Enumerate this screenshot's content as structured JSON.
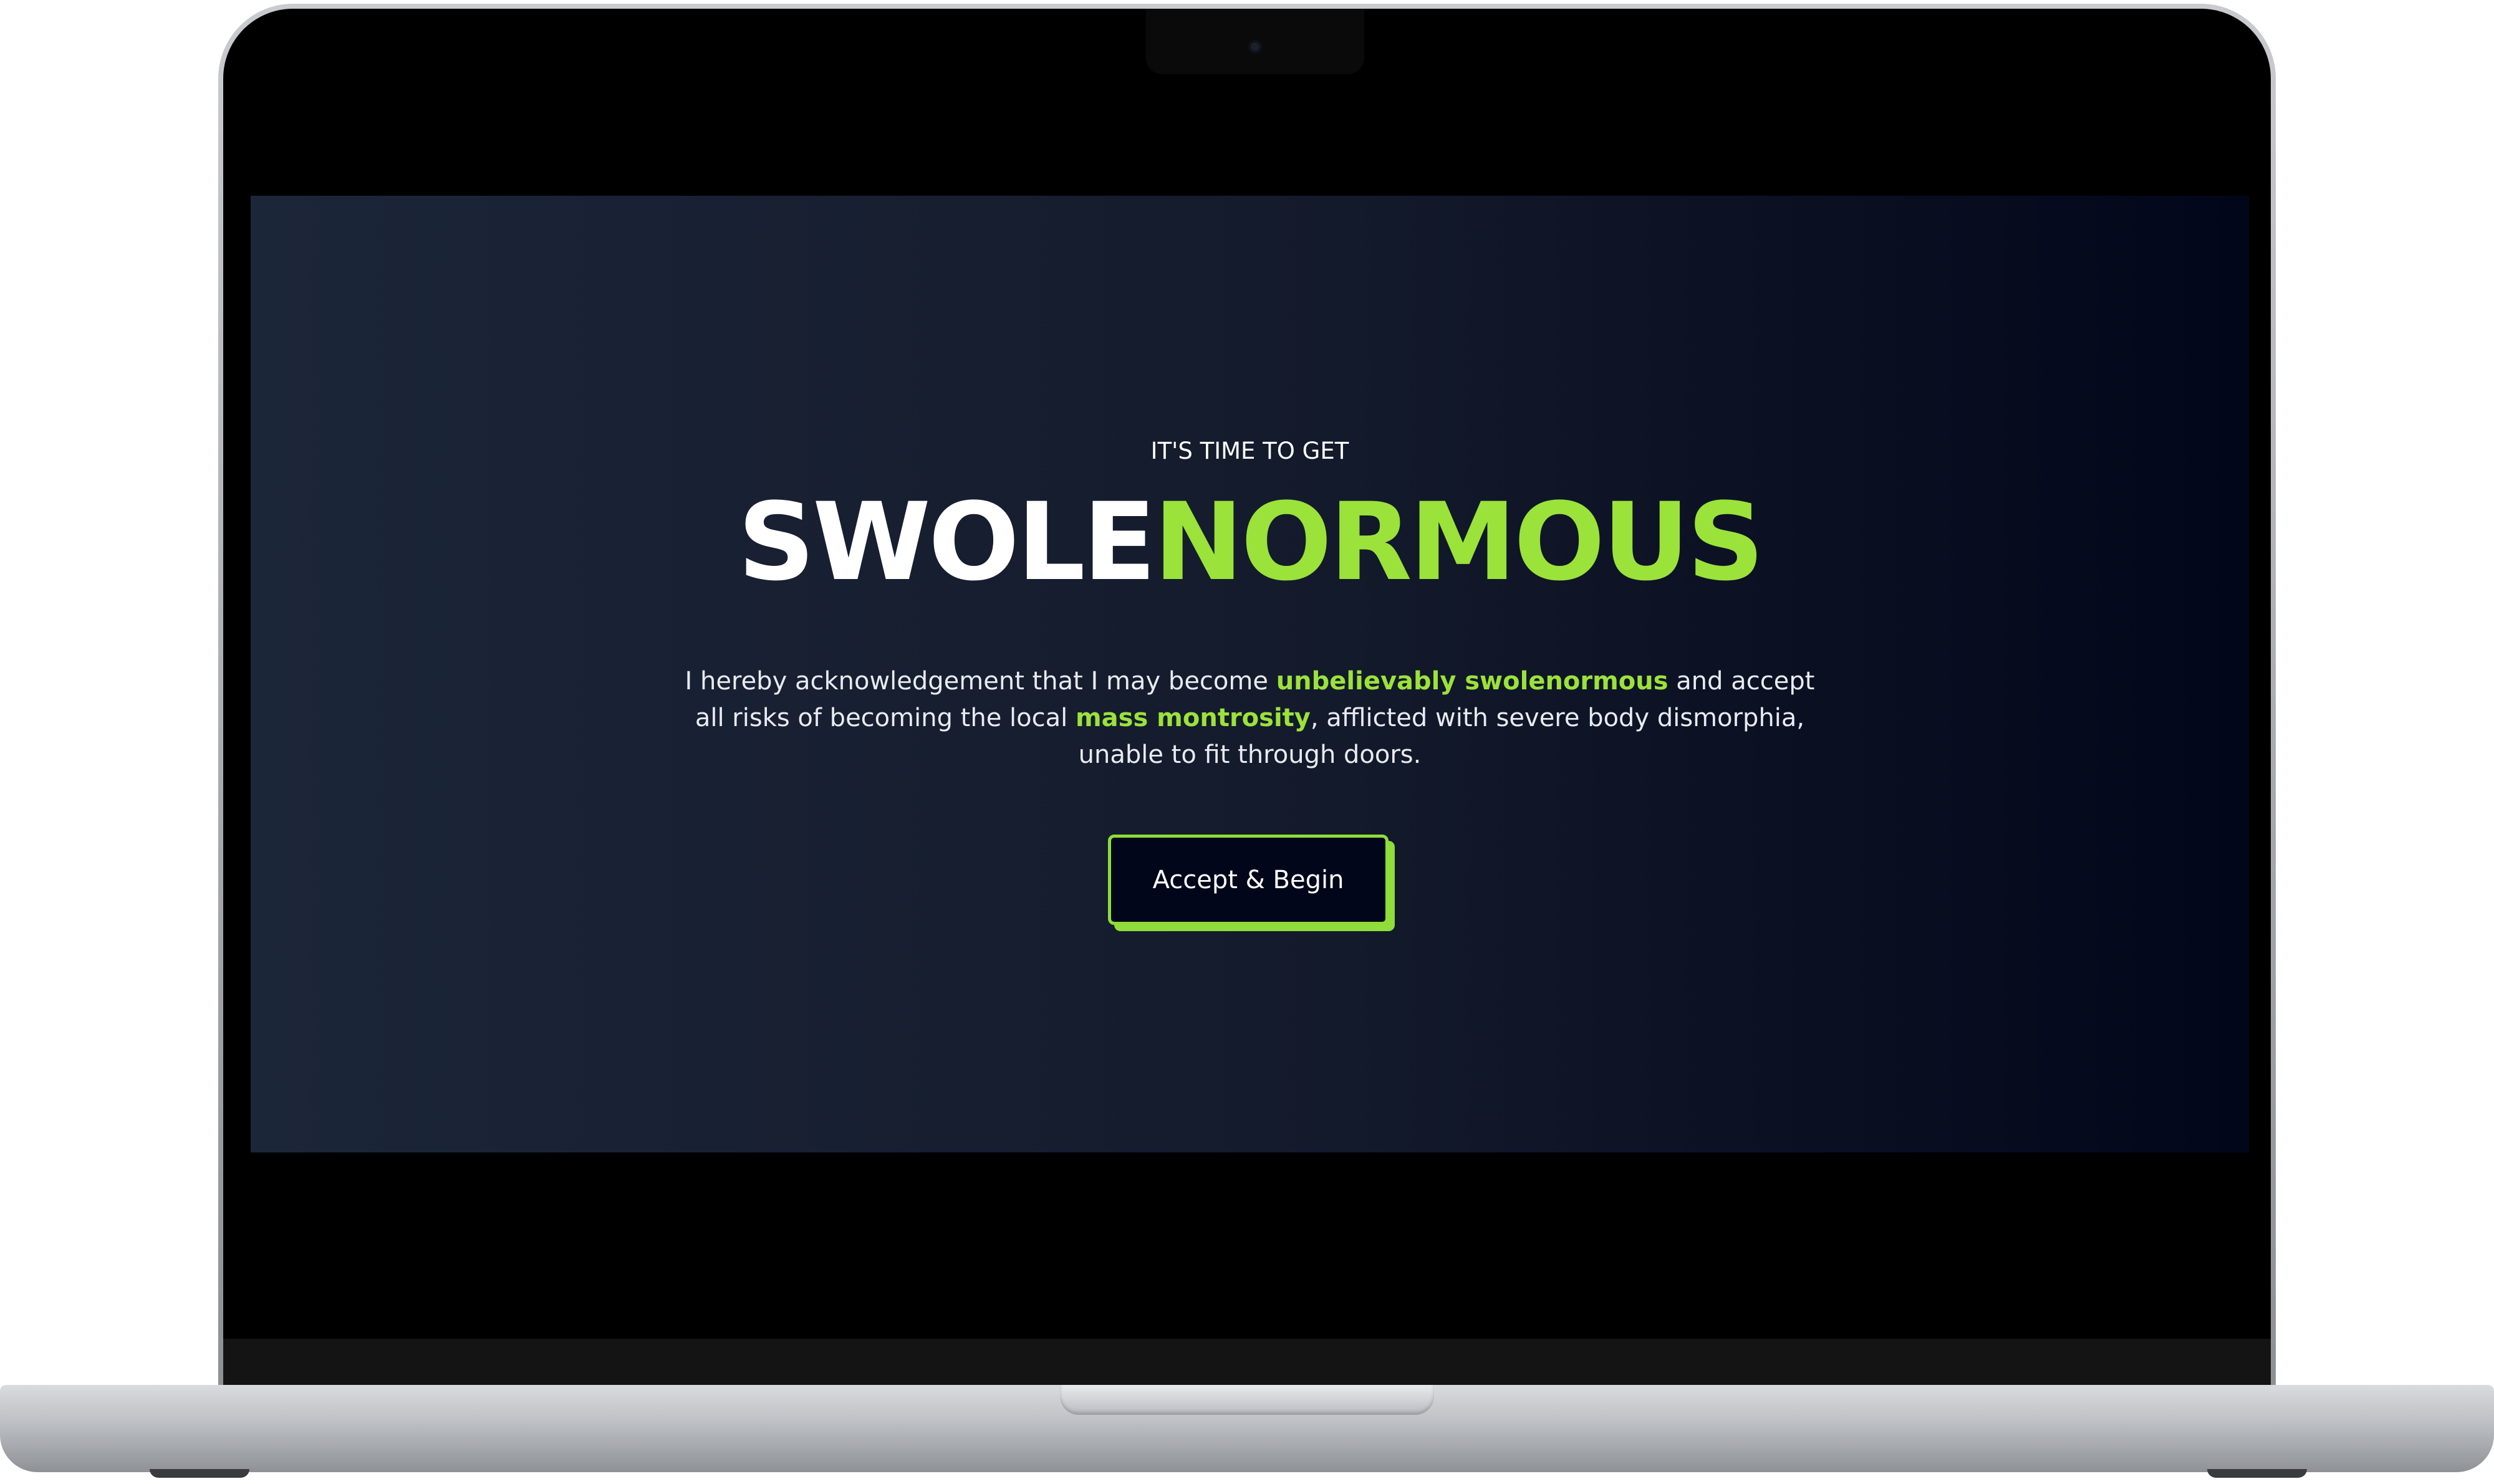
{
  "hero": {
    "eyebrow": "IT'S TIME TO GET",
    "title_part1": "SWOLE",
    "title_part2": "NORMOUS",
    "body": {
      "seg1": "I hereby acknowledgement that I may become ",
      "highlight1": "unbelievably swolenormous",
      "seg2": " and accept all risks of becoming the local ",
      "highlight2": "mass montrosity",
      "seg3": ", afflicted with severe body dismorphia, unable to fit through doors."
    },
    "cta_label": "Accept & Begin"
  },
  "colors": {
    "accent": "#9be23b",
    "background_start": "#1c2639",
    "background_end": "#02061a",
    "text": "#ffffff"
  }
}
